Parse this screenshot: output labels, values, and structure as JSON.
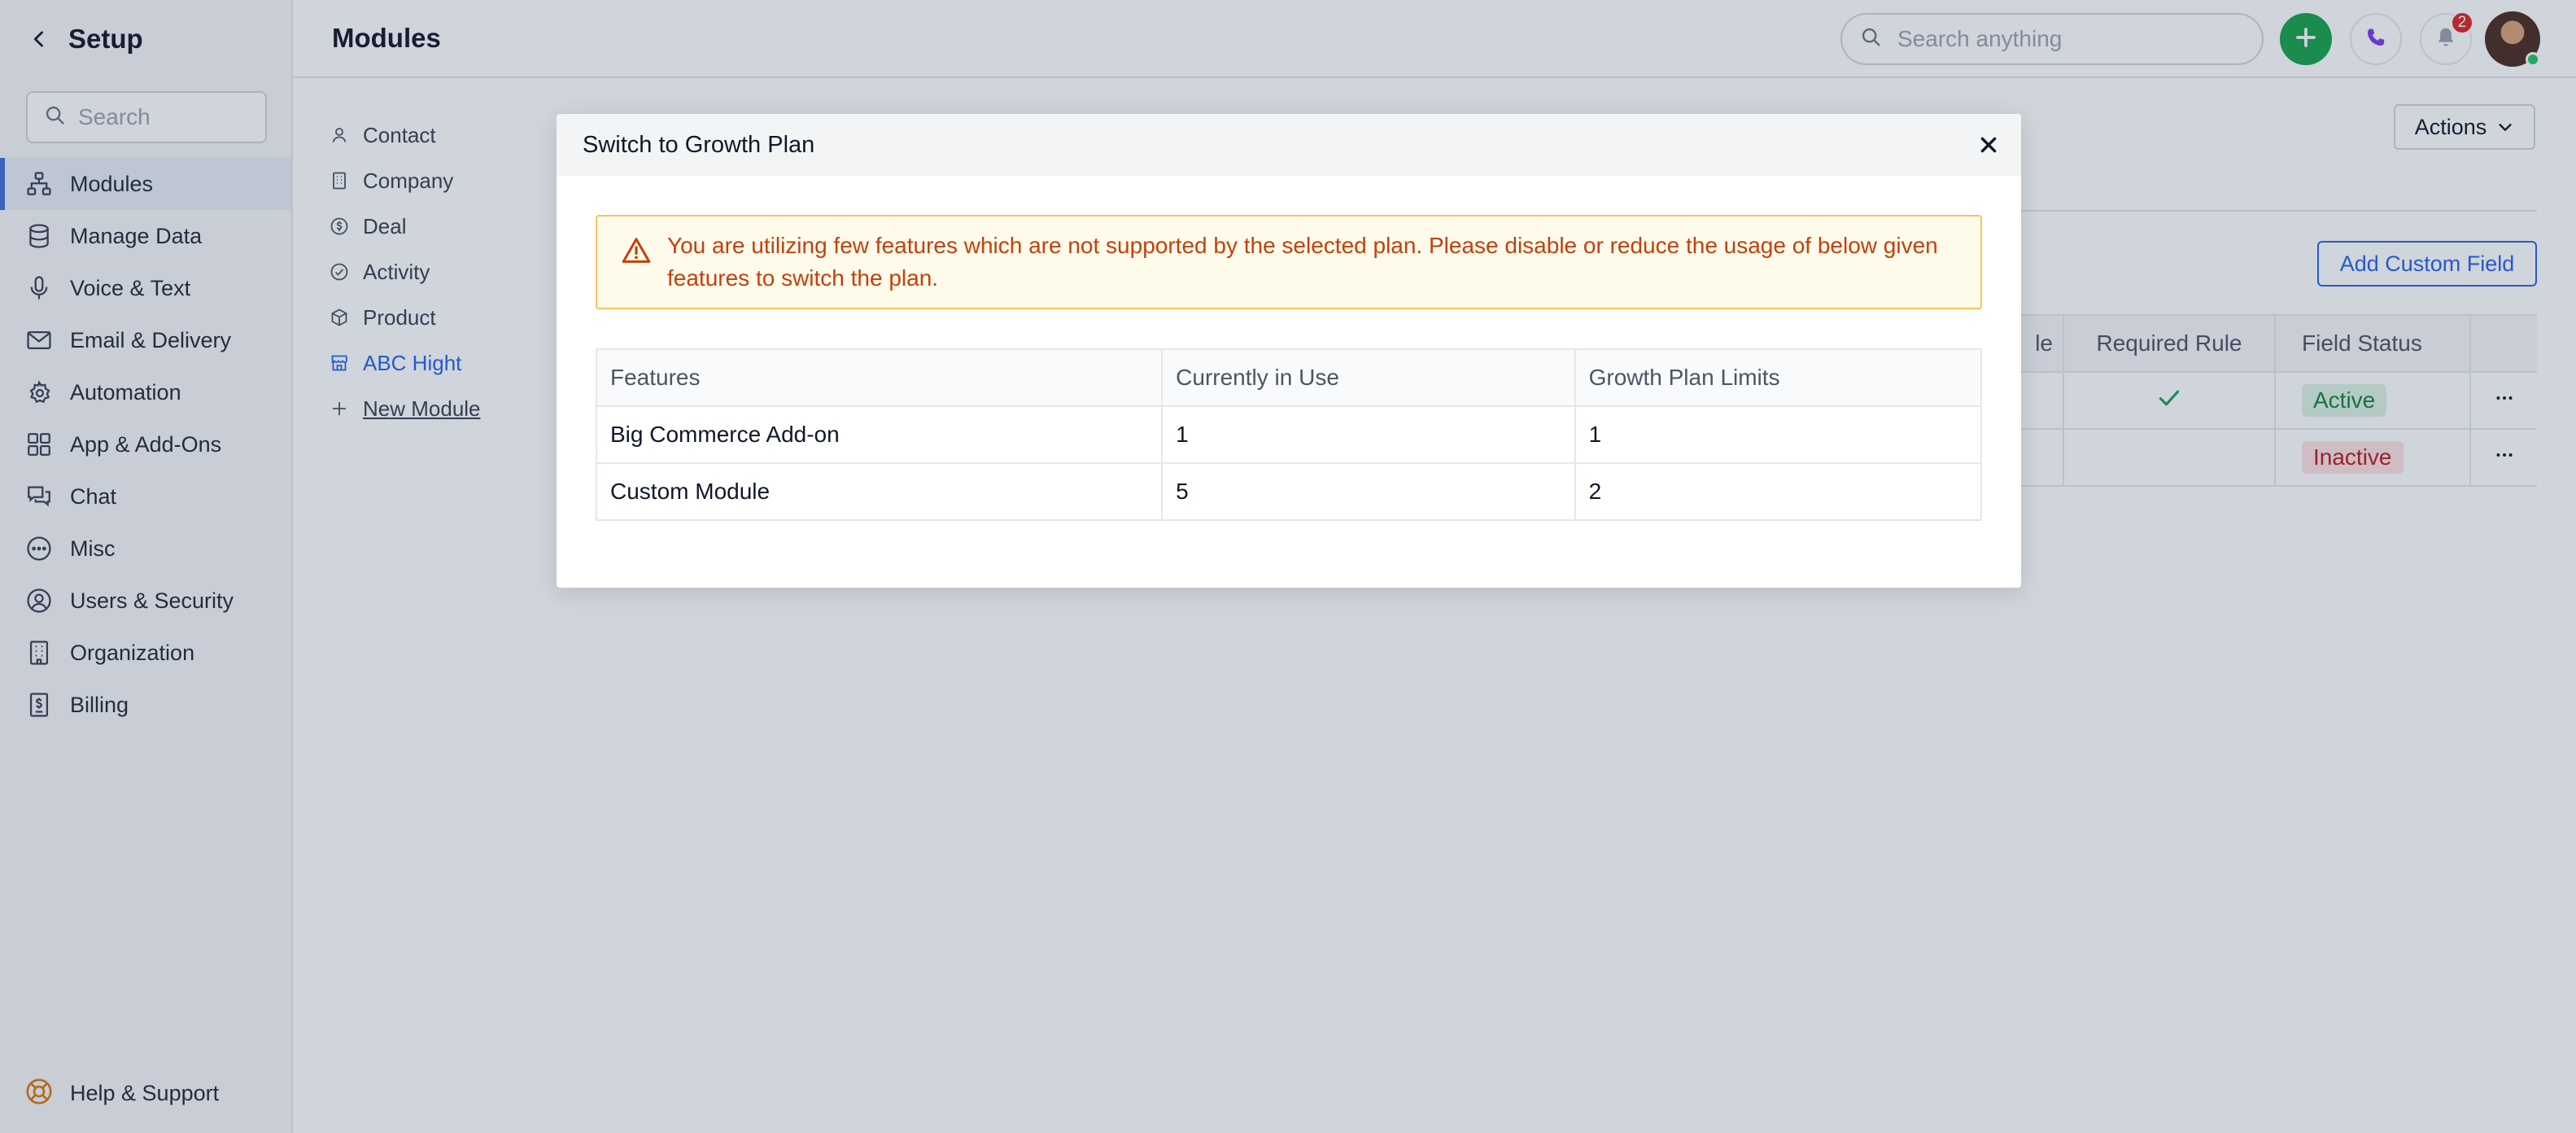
{
  "sidebar": {
    "title": "Setup",
    "search_placeholder": "Search",
    "items": [
      {
        "label": "Modules",
        "icon": "modules-icon"
      },
      {
        "label": "Manage Data",
        "icon": "database-icon"
      },
      {
        "label": "Voice & Text",
        "icon": "microphone-icon"
      },
      {
        "label": "Email & Delivery",
        "icon": "mail-icon"
      },
      {
        "label": "Automation",
        "icon": "automation-icon"
      },
      {
        "label": "App & Add-Ons",
        "icon": "apps-grid-icon"
      },
      {
        "label": "Chat",
        "icon": "chat-icon"
      },
      {
        "label": "Misc",
        "icon": "more-circle-icon"
      },
      {
        "label": "Users & Security",
        "icon": "user-circle-icon"
      },
      {
        "label": "Organization",
        "icon": "building-icon"
      },
      {
        "label": "Billing",
        "icon": "billing-icon"
      }
    ],
    "help_label": "Help & Support"
  },
  "header": {
    "title": "Modules",
    "search_placeholder": "Search anything",
    "notification_count": "2"
  },
  "modules": {
    "items": [
      {
        "label": "Contact",
        "icon": "person-icon"
      },
      {
        "label": "Company",
        "icon": "building-icon"
      },
      {
        "label": "Deal",
        "icon": "dollar-circle-icon"
      },
      {
        "label": "Activity",
        "icon": "check-circle-icon"
      },
      {
        "label": "Product",
        "icon": "box-icon"
      },
      {
        "label": "ABC Hight",
        "icon": "store-icon"
      },
      {
        "label": "New Module",
        "icon": "plus-icon"
      }
    ]
  },
  "toolbar": {
    "actions_label": "Actions",
    "add_custom_field_label": "Add Custom Field"
  },
  "field_table": {
    "headers": [
      "le",
      "Required Rule",
      "Field Status"
    ],
    "rows": [
      {
        "required": true,
        "status": "Active"
      },
      {
        "required": false,
        "status": "Inactive"
      }
    ]
  },
  "modal": {
    "title": "Switch to Growth Plan",
    "warning": "You are utilizing few features which are not supported by the selected plan. Please disable or reduce the usage of below given features to switch the plan.",
    "table": {
      "headers": [
        "Features",
        "Currently in Use",
        "Growth Plan Limits"
      ],
      "rows": [
        [
          "Big Commerce Add-on",
          "1",
          "1"
        ],
        [
          "Custom Module",
          "5",
          "2"
        ]
      ]
    }
  },
  "colors": {
    "accent": "#2563eb",
    "success": "#16a34a",
    "danger": "#dc2626",
    "warning_text": "#c2410c",
    "warning_border": "#f4c55b"
  }
}
